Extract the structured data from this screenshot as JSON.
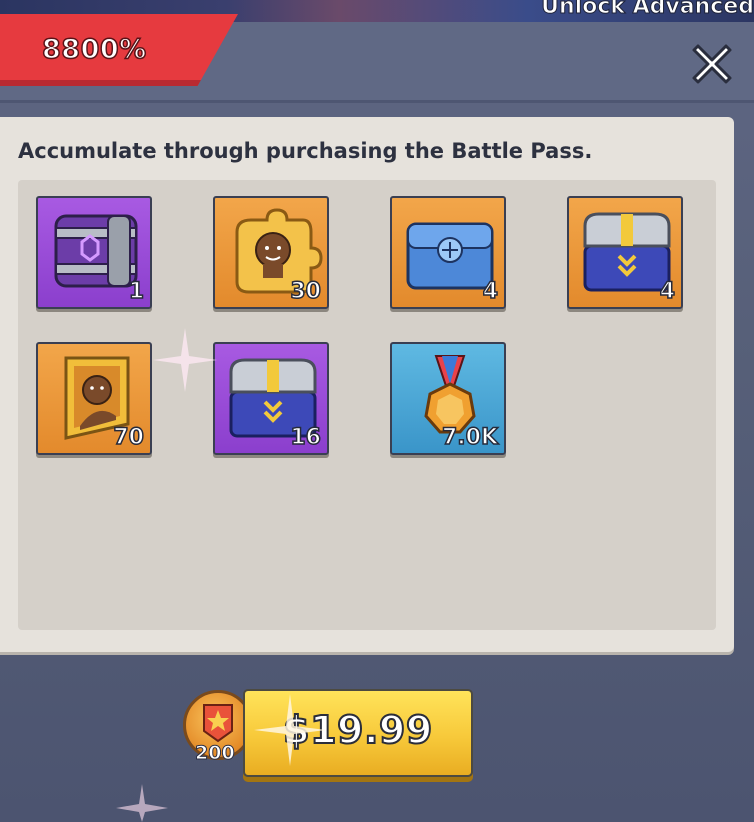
{
  "background_banner": {
    "text": "Unlock Advanced"
  },
  "header": {
    "bonus_percent": "8800%",
    "close_icon": "close-icon"
  },
  "panel": {
    "title": "Accumulate through purchasing the Battle Pass."
  },
  "rewards": [
    {
      "name": "purple-crate",
      "count": "1",
      "tile_color": "purple",
      "icon": "purple-crate-icon"
    },
    {
      "name": "hero-puzzle-pieces",
      "count": "30",
      "tile_color": "orange",
      "icon": "hero-puzzle-icon"
    },
    {
      "name": "blue-chest",
      "count": "4",
      "tile_color": "orange",
      "icon": "blue-chest-icon"
    },
    {
      "name": "silver-chest",
      "count": "4",
      "tile_color": "orange",
      "icon": "silver-chest-icon"
    },
    {
      "name": "hero-portrait-frame",
      "count": "70",
      "tile_color": "orange",
      "icon": "portrait-frame-icon"
    },
    {
      "name": "silver-chest-purple",
      "count": "16",
      "tile_color": "purple",
      "icon": "silver-chest-icon"
    },
    {
      "name": "medal",
      "count": "7.0K",
      "tile_color": "blue",
      "icon": "medal-icon"
    }
  ],
  "purchase": {
    "points_count": "200",
    "points_icon": "star-medal-icon",
    "price": "$19.99"
  },
  "colors": {
    "badge_red": "#e63a3f",
    "button_yellow": "#f7c93a",
    "tile_orange": "#e9952f",
    "tile_purple": "#9a4cd8",
    "tile_blue": "#4aa6d6"
  }
}
